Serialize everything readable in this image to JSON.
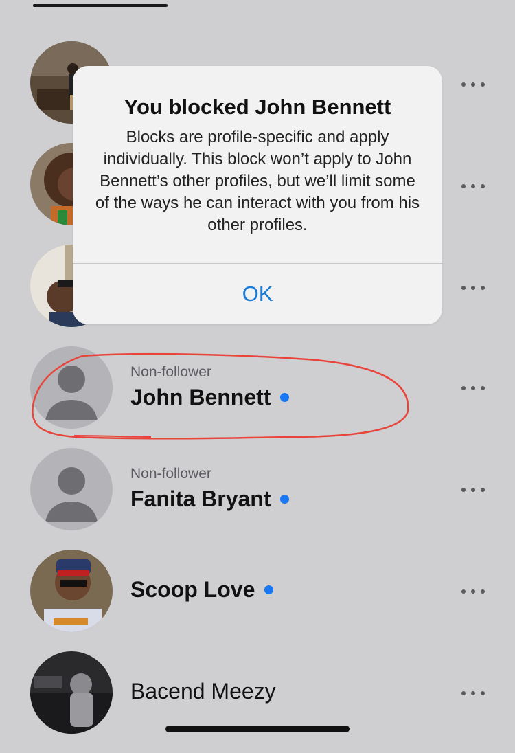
{
  "dialog": {
    "title": "You blocked John Bennett",
    "body": "Blocks are profile-specific and apply individually. This block won’t apply to John Bennett’s other profiles, but we’ll limit some of the ways he can interact with you from his other profiles.",
    "ok_label": "OK"
  },
  "rows": [
    {
      "subtitle": "",
      "name": "",
      "avatar": "photo-person-indoor",
      "more_icon": "more-horizontal-icon"
    },
    {
      "subtitle": "",
      "name": "",
      "avatar": "photo-woman-smiling",
      "more_icon": "more-horizontal-icon"
    },
    {
      "subtitle": "",
      "name": "",
      "avatar": "photo-man-in-car",
      "more_icon": "more-horizontal-icon"
    },
    {
      "subtitle": "Non-follower",
      "name": "John Bennett",
      "avatar": "default-person-icon",
      "unread": true,
      "more_icon": "more-horizontal-icon"
    },
    {
      "subtitle": "Non-follower",
      "name": "Fanita Bryant",
      "avatar": "default-person-icon",
      "unread": true,
      "more_icon": "more-horizontal-icon"
    },
    {
      "subtitle": "",
      "name": "Scoop Love",
      "avatar": "photo-man-red-cap",
      "unread": true,
      "more_icon": "more-horizontal-icon"
    },
    {
      "subtitle": "",
      "name": "Bacend Meezy",
      "avatar": "photo-man-hoodie-car",
      "unread": false,
      "more_icon": "more-horizontal-icon"
    }
  ],
  "colors": {
    "background": "#cfcfd2",
    "unread_dot": "#1877f2",
    "ok_button": "#1a7bd8",
    "highlight_annotation": "#e8443a"
  }
}
